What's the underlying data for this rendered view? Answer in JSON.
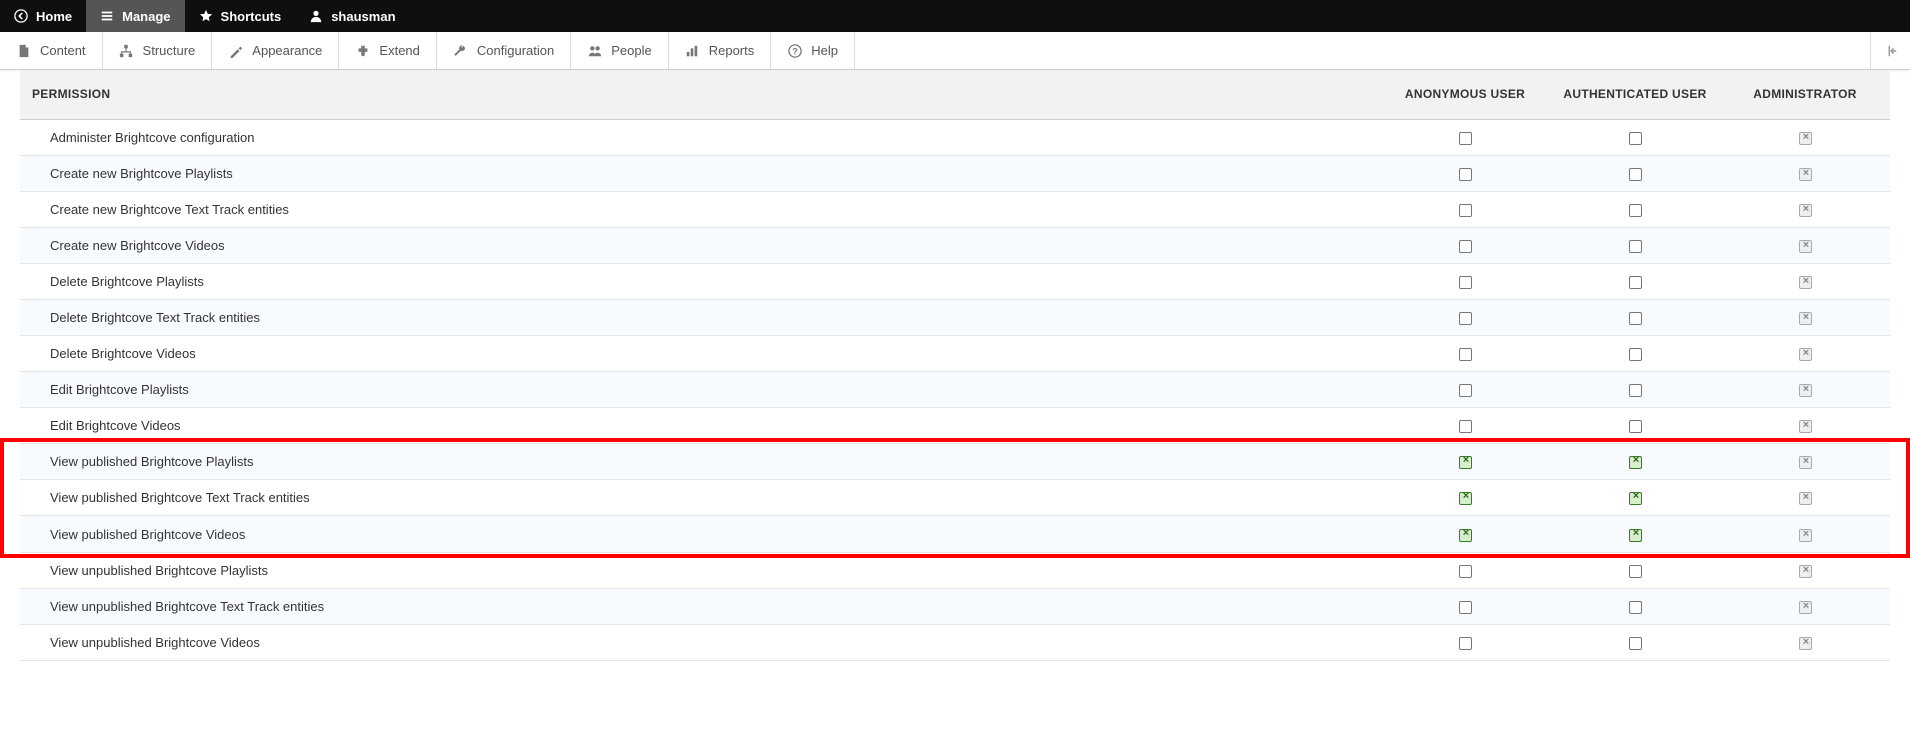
{
  "topbar": {
    "home": "Home",
    "manage": "Manage",
    "shortcuts": "Shortcuts",
    "user": "shausman"
  },
  "adminbar": {
    "content": "Content",
    "structure": "Structure",
    "appearance": "Appearance",
    "extend": "Extend",
    "configuration": "Configuration",
    "people": "People",
    "reports": "Reports",
    "help": "Help"
  },
  "table": {
    "headers": {
      "permission": "Permission",
      "anon": "Anonymous user",
      "auth": "Authenticated user",
      "admin": "Administrator"
    },
    "rows": [
      {
        "label": "Administer Brightcove configuration",
        "anon": "unchecked",
        "auth": "unchecked",
        "admin": "disabled-checked"
      },
      {
        "label": "Create new Brightcove Playlists",
        "anon": "unchecked",
        "auth": "unchecked",
        "admin": "disabled-checked"
      },
      {
        "label": "Create new Brightcove Text Track entities",
        "anon": "unchecked",
        "auth": "unchecked",
        "admin": "disabled-checked"
      },
      {
        "label": "Create new Brightcove Videos",
        "anon": "unchecked",
        "auth": "unchecked",
        "admin": "disabled-checked"
      },
      {
        "label": "Delete Brightcove Playlists",
        "anon": "unchecked",
        "auth": "unchecked",
        "admin": "disabled-checked"
      },
      {
        "label": "Delete Brightcove Text Track entities",
        "anon": "unchecked",
        "auth": "unchecked",
        "admin": "disabled-checked"
      },
      {
        "label": "Delete Brightcove Videos",
        "anon": "unchecked",
        "auth": "unchecked",
        "admin": "disabled-checked"
      },
      {
        "label": "Edit Brightcove Playlists",
        "anon": "unchecked",
        "auth": "unchecked",
        "admin": "disabled-checked"
      },
      {
        "label": "Edit Brightcove Videos",
        "anon": "unchecked",
        "auth": "unchecked",
        "admin": "disabled-checked"
      },
      {
        "label": "View published Brightcove Playlists",
        "anon": "checked-green",
        "auth": "checked-green",
        "admin": "disabled-checked",
        "highlight": true
      },
      {
        "label": "View published Brightcove Text Track entities",
        "anon": "checked-green",
        "auth": "checked-green",
        "admin": "disabled-checked",
        "highlight": true
      },
      {
        "label": "View published Brightcove Videos",
        "anon": "checked-green",
        "auth": "checked-green",
        "admin": "disabled-checked",
        "highlight": true
      },
      {
        "label": "View unpublished Brightcove Playlists",
        "anon": "unchecked",
        "auth": "unchecked",
        "admin": "disabled-checked"
      },
      {
        "label": "View unpublished Brightcove Text Track entities",
        "anon": "unchecked",
        "auth": "unchecked",
        "admin": "disabled-checked"
      },
      {
        "label": "View unpublished Brightcove Videos",
        "anon": "unchecked",
        "auth": "unchecked",
        "admin": "disabled-checked"
      }
    ]
  }
}
